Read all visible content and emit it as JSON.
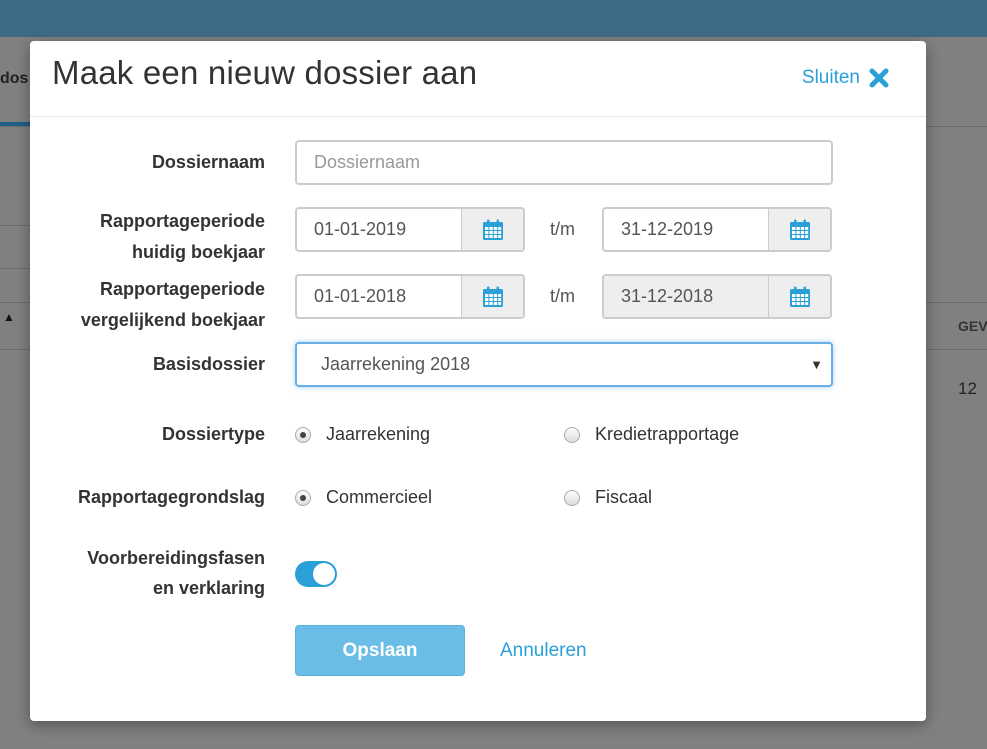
{
  "background": {
    "tab_label": "dos",
    "column_header": "GEV",
    "cell_value": "12"
  },
  "modal": {
    "title": "Maak een nieuw dossier aan",
    "close_label": "Sluiten",
    "fields": {
      "dossiernaam": {
        "label": "Dossiernaam",
        "placeholder": "Dossiernaam",
        "value": ""
      },
      "period_current": {
        "label_line1": "Rapportageperiode",
        "label_line2": "huidig boekjaar",
        "start": "01-01-2019",
        "separator": "t/m",
        "end": "31-12-2019"
      },
      "period_compare": {
        "label_line1": "Rapportageperiode",
        "label_line2": "vergelijkend boekjaar",
        "start": "01-01-2018",
        "separator": "t/m",
        "end": "31-12-2018"
      },
      "basisdossier": {
        "label": "Basisdossier",
        "selected": "Jaarrekening 2018"
      },
      "dossiertype": {
        "label": "Dossiertype",
        "options": [
          "Jaarrekening",
          "Kredietrapportage"
        ],
        "selected": "Jaarrekening"
      },
      "grondslag": {
        "label": "Rapportagegrondslag",
        "options": [
          "Commercieel",
          "Fiscaal"
        ],
        "selected": "Commercieel"
      },
      "voorbereiding": {
        "label_line1": "Voorbereidingsfasen",
        "label_line2": "en verklaring",
        "enabled": true
      }
    },
    "actions": {
      "save_label": "Opslaan",
      "cancel_label": "Annuleren"
    }
  },
  "colors": {
    "accent": "#2a9fd8",
    "save_button": "#69bde6",
    "topbar": "#3d6a85"
  }
}
